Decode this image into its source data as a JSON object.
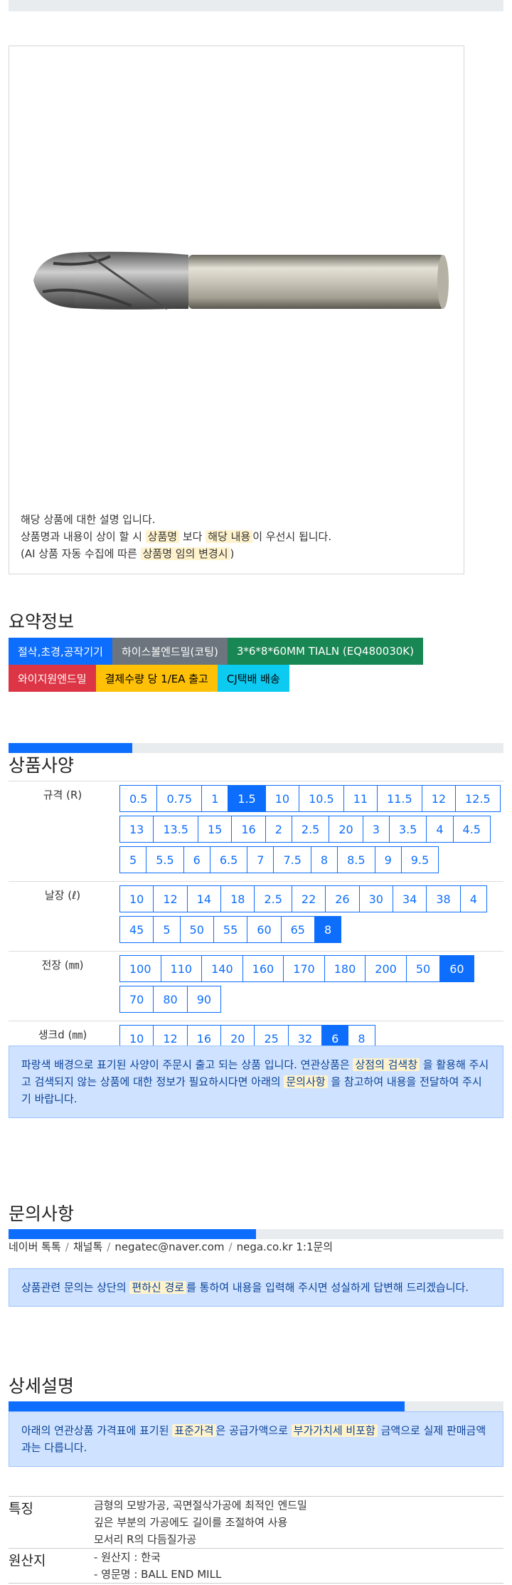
{
  "notice": {
    "line1": "해당 상품에 대한 설명 입니다.",
    "line2_a": "상품명과 내용이 상이 할 시",
    "line2_hl1": "상품명",
    "line2_b": "보다",
    "line2_hl2": "해당 내용",
    "line2_c": "이 우선시 됩니다.",
    "line3_a": "(AI 상품 자동 수집에 따른",
    "line3_hl": "상품명 임의 변경시",
    "line3_b": ")"
  },
  "summary": {
    "title": "요약정보",
    "badges_row1": [
      "절삭,초경,공작기기",
      "하이스볼엔드밀(코팅)",
      "3*6*8*60MM TIALN (EQ480030K)"
    ],
    "badges_row2": [
      "와이지원엔드밀",
      "결제수량 당 1/EA 출고",
      "CJ택배 배송"
    ]
  },
  "spec": {
    "title": "상품사양",
    "progress": 0.25,
    "rows": [
      {
        "label": "규격 (R)",
        "options": [
          "0.5",
          "0.75",
          "1",
          "1.5",
          "10",
          "10.5",
          "11",
          "11.5",
          "12",
          "12.5",
          "13",
          "13.5",
          "15",
          "16",
          "2",
          "2.5",
          "20",
          "3",
          "3.5",
          "4",
          "4.5",
          "5",
          "5.5",
          "6",
          "6.5",
          "7",
          "7.5",
          "8",
          "8.5",
          "9",
          "9.5"
        ],
        "selected": "1.5"
      },
      {
        "label": "날장 (ℓ)",
        "options": [
          "10",
          "12",
          "14",
          "18",
          "2.5",
          "22",
          "26",
          "30",
          "34",
          "38",
          "4",
          "45",
          "5",
          "50",
          "55",
          "60",
          "65",
          "8"
        ],
        "selected": "8"
      },
      {
        "label": "전장 (㎜)",
        "options": [
          "100",
          "110",
          "140",
          "160",
          "170",
          "180",
          "200",
          "50",
          "60",
          "70",
          "80",
          "90"
        ],
        "selected": "60"
      },
      {
        "label": "생크d (㎜)",
        "options": [
          "10",
          "12",
          "16",
          "20",
          "25",
          "32",
          "6",
          "8"
        ],
        "selected": "6"
      }
    ],
    "alert_a": "파랑색 배경으로 표기된 사양이 주문시 출고 되는 상품 입니다. 연관상품은",
    "alert_hl1": "상점의 검색창",
    "alert_b": "을 활용해 주시고 검색되지 않는 상품에 대한 정보가 필요하시다면 아래의",
    "alert_hl2": "문의사항",
    "alert_c": "을 참고하여 내용을 전달하여 주시기 바랍니다."
  },
  "inquiry": {
    "title": "문의사항",
    "progress": 0.5,
    "contacts": [
      "네이버 톡톡",
      "채널톡",
      "negatec@naver.com",
      "nega.co.kr 1:1문의"
    ],
    "separator": "/",
    "alert_a": "상품관련 문의는 상단의",
    "alert_hl": "편하신 경로",
    "alert_b": "를 통하여 내용을 입력해 주시면 성실하게 답변해 드리겠습니다."
  },
  "detail": {
    "title": "상세설명",
    "progress": 0.8,
    "alert_a": "아래의 연관상품 가격표에 표기된",
    "alert_hl1": "표준가격",
    "alert_b": "은 공급가액으로",
    "alert_hl2": "부가가치세 비포함",
    "alert_c": "금액으로 실제 판매금액과는 다릅니다."
  },
  "features": {
    "label1": "특징",
    "lines1": [
      "금형의 모방가공, 곡면절삭가공에 최적인 엔드밀",
      "깊은 부분의 가공에도 길이를 조절하여 사용",
      "모서리 R의 다듬질가공"
    ],
    "label2": "원산지",
    "lines2": [
      "- 원산지 : 한국",
      "- 영문명 : BALL END MILL"
    ]
  }
}
